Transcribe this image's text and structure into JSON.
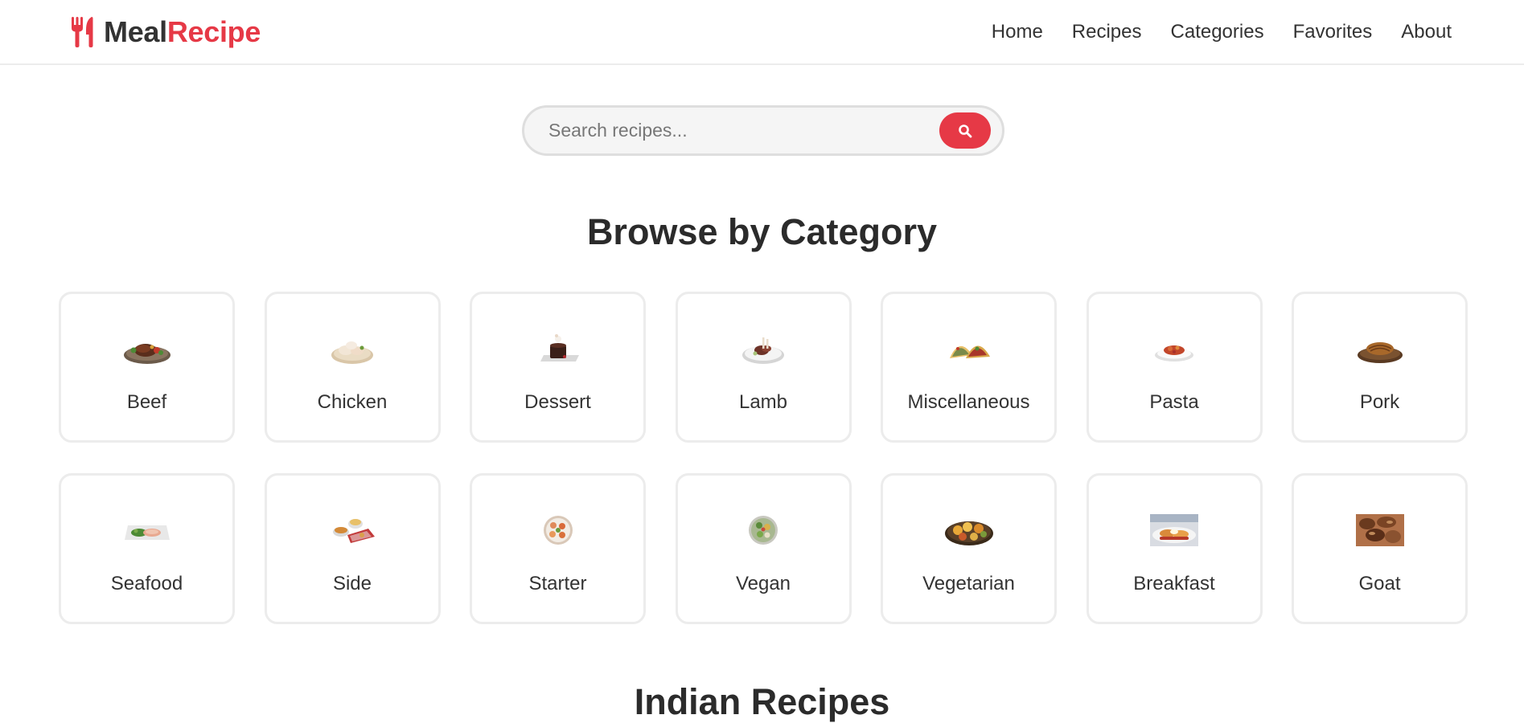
{
  "header": {
    "logo": {
      "part1": "Meal",
      "part2": "Recipe",
      "icon": "utensils-icon"
    },
    "nav": [
      "Home",
      "Recipes",
      "Categories",
      "Favorites",
      "About"
    ]
  },
  "search": {
    "placeholder": "Search recipes...",
    "value": "",
    "icon": "search-icon"
  },
  "sections": {
    "browse_title": "Browse by Category",
    "indian_title": "Indian Recipes"
  },
  "categories": [
    {
      "label": "Beef",
      "icon": "beef-dish-image"
    },
    {
      "label": "Chicken",
      "icon": "chicken-dish-image"
    },
    {
      "label": "Dessert",
      "icon": "dessert-dish-image"
    },
    {
      "label": "Lamb",
      "icon": "lamb-dish-image"
    },
    {
      "label": "Miscellaneous",
      "icon": "tacos-dish-image"
    },
    {
      "label": "Pasta",
      "icon": "pasta-dish-image"
    },
    {
      "label": "Pork",
      "icon": "pork-dish-image"
    },
    {
      "label": "Seafood",
      "icon": "seafood-dish-image"
    },
    {
      "label": "Side",
      "icon": "side-dish-image"
    },
    {
      "label": "Starter",
      "icon": "starter-dish-image"
    },
    {
      "label": "Vegan",
      "icon": "vegan-dish-image"
    },
    {
      "label": "Vegetarian",
      "icon": "vegetarian-dish-image"
    },
    {
      "label": "Breakfast",
      "icon": "breakfast-dish-image"
    },
    {
      "label": "Goat",
      "icon": "goat-dish-image"
    }
  ],
  "colors": {
    "accent": "#e63946",
    "text": "#333333",
    "border": "#ececec"
  }
}
